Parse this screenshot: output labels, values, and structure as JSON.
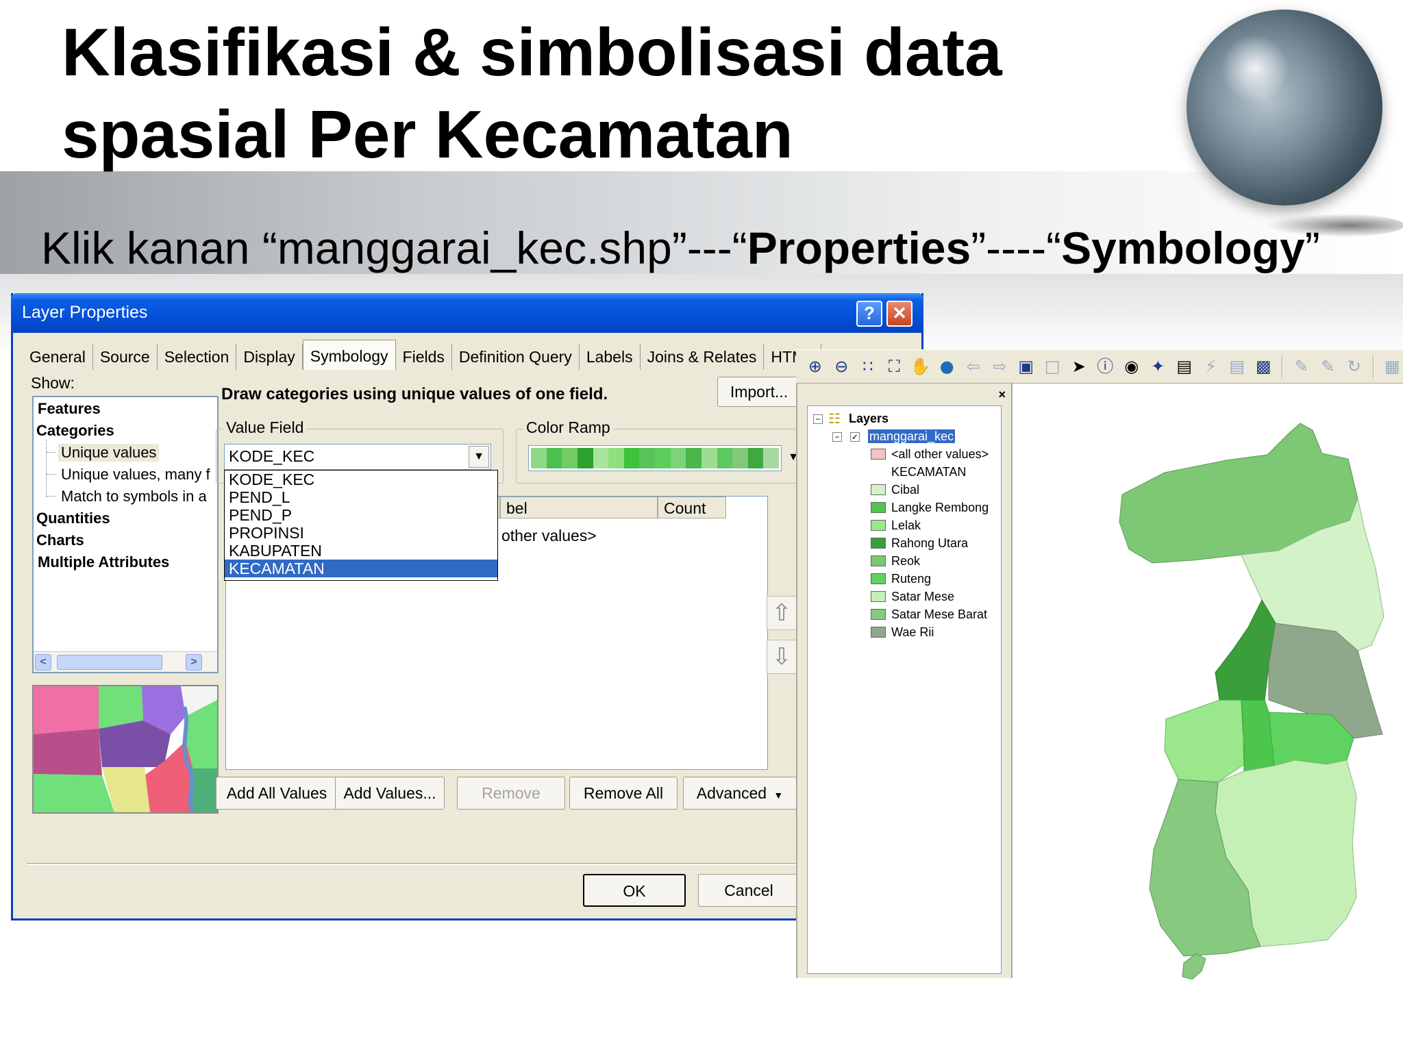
{
  "slide": {
    "title_line1": "Klasifikasi & simbolisasi data",
    "title_line2": "spasial Per Kecamatan",
    "subtitle_prefix": "Klik kanan “manggarai_kec.shp”---“",
    "subtitle_b1": "Properties",
    "subtitle_mid": "”----“",
    "subtitle_b2": "Symbology",
    "subtitle_suffix": "”"
  },
  "dialog": {
    "title": "Layer Properties",
    "help_label": "?",
    "close_label": "✕",
    "tabs": [
      "General",
      "Source",
      "Selection",
      "Display",
      "Symbology",
      "Fields",
      "Definition Query",
      "Labels",
      "Joins & Relates",
      "HTML"
    ],
    "active_tab": "Symbology",
    "show_label": "Show:",
    "tree": {
      "features": "Features",
      "categories": "Categories",
      "unique_values": "Unique values",
      "unique_many": "Unique values, many f",
      "match_symbols": "Match to symbols in a",
      "quantities": "Quantities",
      "charts": "Charts",
      "multiple": "Multiple Attributes"
    },
    "description": "Draw categories using unique values of one field.",
    "import_label": "Import...",
    "value_field_label": "Value Field",
    "value_field_selected": "KODE_KEC",
    "value_field_options": [
      "KODE_KEC",
      "PEND_L",
      "PEND_P",
      "PROPINSI",
      "KABUPATEN",
      "KECAMATAN"
    ],
    "value_field_highlighted": "KECAMATAN",
    "color_ramp_label": "Color Ramp",
    "color_ramp": [
      "#8fd88a",
      "#4cbf4c",
      "#72cc66",
      "#2ea02e",
      "#a8e59a",
      "#8ce07e",
      "#3cc23c",
      "#58c458",
      "#5bcf5b",
      "#7ed37a",
      "#49b749",
      "#9fdc93",
      "#5ec95e",
      "#81c97a",
      "#3fa83f",
      "#a8d8a0"
    ],
    "columns": [
      "bel",
      "Count"
    ],
    "other_values": "other values>",
    "buttons": {
      "add_all": "Add All Values",
      "add_values": "Add Values...",
      "remove": "Remove",
      "remove_all": "Remove All",
      "advanced": "Advanced",
      "ok": "OK",
      "cancel": "Cancel"
    }
  },
  "toc": {
    "root": "Layers",
    "layer": "manggarai_kec",
    "other_values": "<all other values>",
    "field": "KECAMATAN",
    "classes": [
      {
        "label": "Cibal",
        "color": "#d3f2c8"
      },
      {
        "label": "Langke Rembong",
        "color": "#4cc64c"
      },
      {
        "label": "Lelak",
        "color": "#9be88c"
      },
      {
        "label": "Rahong Utara",
        "color": "#3a9e3a"
      },
      {
        "label": "Reok",
        "color": "#7ec774"
      },
      {
        "label": "Ruteng",
        "color": "#5fd25f"
      },
      {
        "label": "Satar Mese",
        "color": "#c4f0b6"
      },
      {
        "label": "Satar Mese Barat",
        "color": "#86c97f"
      },
      {
        "label": "Wae Rii",
        "color": "#8fa88c"
      }
    ],
    "other_color": "#f4c2c2"
  }
}
